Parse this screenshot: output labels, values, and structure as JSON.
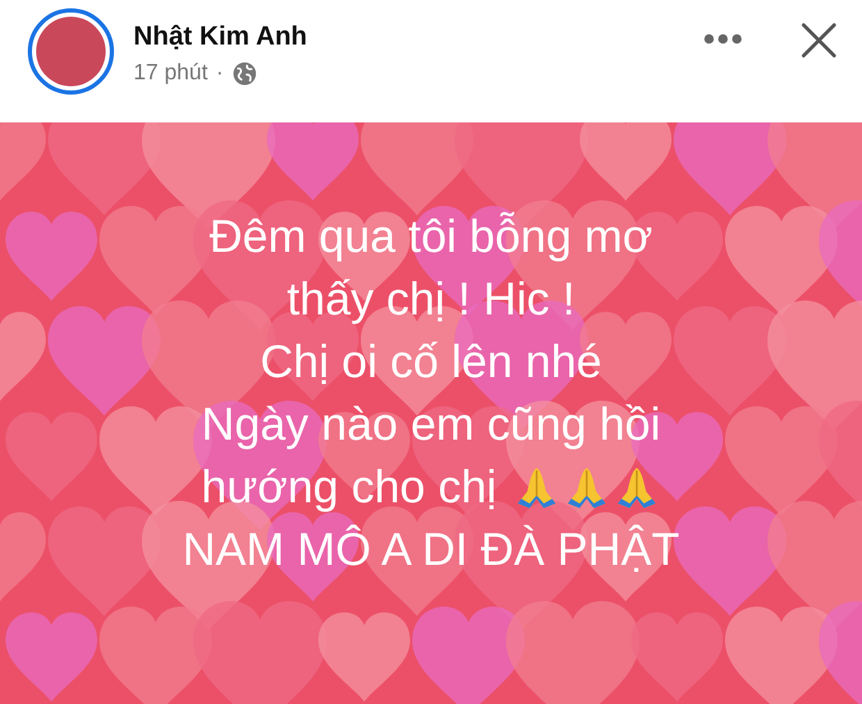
{
  "post": {
    "author": "Nhật Kim Anh",
    "time": "17 phút",
    "separator": "·",
    "lines": [
      {
        "kind": "plain",
        "text": "Đêm qua tôi bỗng mơ"
      },
      {
        "kind": "plain",
        "text": "thấy chị ! Hic !"
      },
      {
        "kind": "plain",
        "text": "Chị oi cố lên nhé"
      },
      {
        "kind": "plain",
        "text": "Ngày nào em cũng hồi"
      },
      {
        "kind": "prayer",
        "text": "hướng cho chị"
      },
      {
        "kind": "plain",
        "text": "NAM MÔ A DI ĐÀ PHẬT"
      }
    ]
  }
}
